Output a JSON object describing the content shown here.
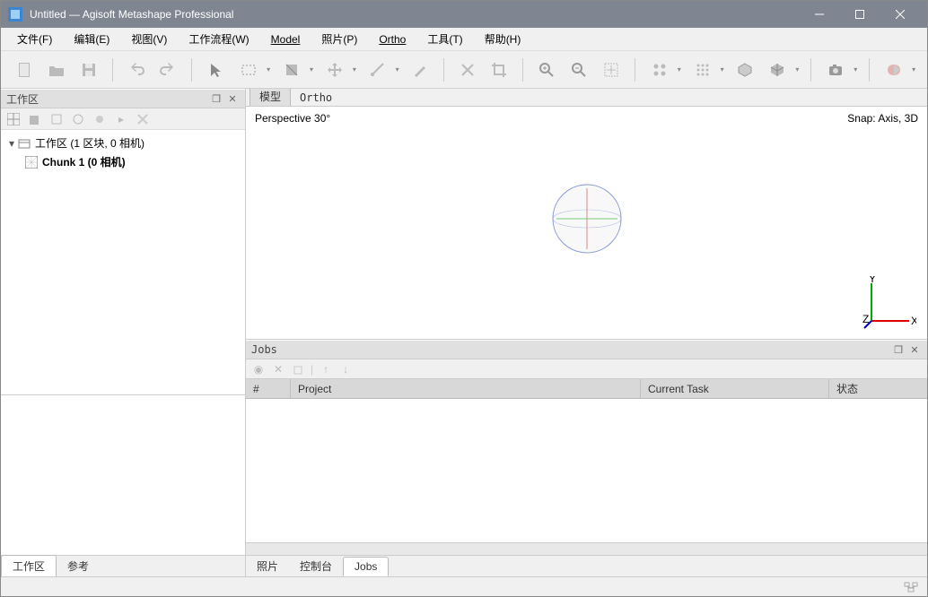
{
  "window": {
    "title": "Untitled — Agisoft Metashape Professional"
  },
  "menu": {
    "file": "文件(F)",
    "edit": "编辑(E)",
    "view": "视图(V)",
    "workflow": "工作流程(W)",
    "model": "Model",
    "photo": "照片(P)",
    "ortho": "Ortho",
    "tools": "工具(T)",
    "help": "帮助(H)"
  },
  "toolbar_icons": {
    "new": "new-doc-icon",
    "open": "open-icon",
    "save": "save-icon",
    "undo": "undo-icon",
    "redo": "redo-icon",
    "cursor": "cursor-icon",
    "rect": "rect-select-icon",
    "region": "region-icon",
    "move": "move-icon",
    "ruler": "ruler-icon",
    "draw": "draw-icon",
    "delete": "delete-icon",
    "crop": "crop-icon",
    "zoomin": "zoom-in-icon",
    "zoomout": "zoom-out-icon",
    "fit": "fit-icon",
    "pts": "pointcloud-icon",
    "dense": "dense-icon",
    "mesh": "mesh-icon",
    "tex": "texture-icon",
    "camera": "camera-icon",
    "record": "record-icon"
  },
  "workspace": {
    "panel_title": "工作区",
    "root_label": "工作区 (1 区块, 0 相机)",
    "chunk_label": "Chunk 1 (0 相机)"
  },
  "viewport": {
    "tab_model": "模型",
    "tab_ortho": "Ortho",
    "perspective": "Perspective 30°",
    "snap": "Snap: Axis, 3D",
    "axis_x": "X",
    "axis_y": "Y",
    "axis_z": "Z"
  },
  "jobs": {
    "title": "Jobs",
    "col_num": "#",
    "col_project": "Project",
    "col_task": "Current Task",
    "col_status": "状态"
  },
  "bottom_tabs_left": {
    "workspace": "工作区",
    "reference": "参考"
  },
  "bottom_tabs_right": {
    "photos": "照片",
    "console": "控制台",
    "jobs": "Jobs"
  }
}
